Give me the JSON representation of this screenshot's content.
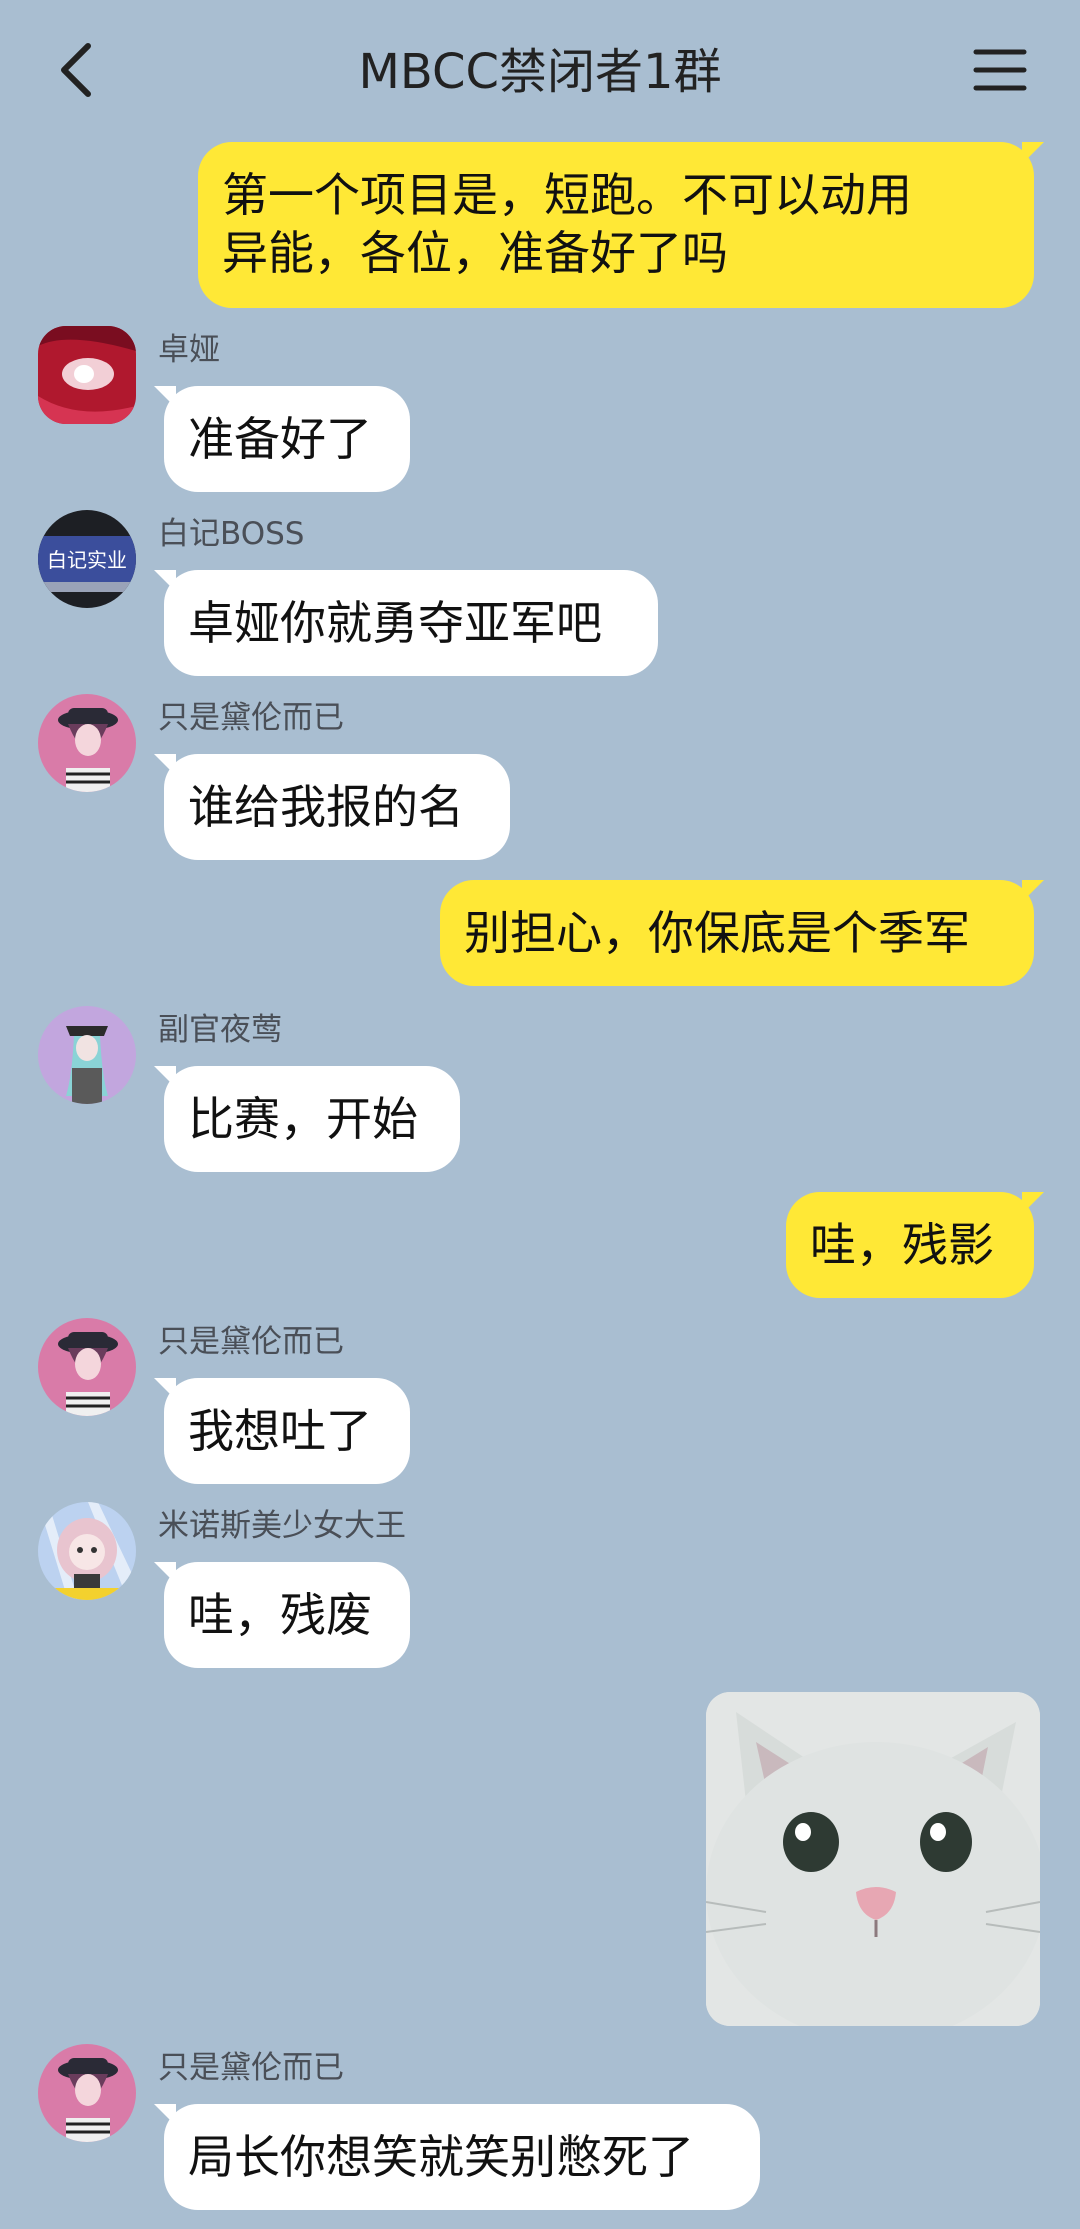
{
  "header": {
    "title": "MBCC禁闭者1群",
    "back_icon": "chevron-left-icon",
    "menu_icon": "hamburger-menu-icon"
  },
  "colors": {
    "background": "#a9bed1",
    "outgoing_bubble": "#ffe836",
    "incoming_bubble": "#ffffff"
  },
  "messages": [
    {
      "direction": "outgoing",
      "text_line1": "第一个项目是，短跑。不可以动用",
      "text_line2": "异能，各位，准备好了吗"
    },
    {
      "direction": "incoming",
      "sender": "卓娅",
      "text": "准备好了"
    },
    {
      "direction": "incoming",
      "sender": "白记BOSS",
      "avatar_text": "白记实业",
      "text": "卓娅你就勇夺亚军吧"
    },
    {
      "direction": "incoming",
      "sender": "只是黛伦而已",
      "text": "谁给我报的名"
    },
    {
      "direction": "outgoing",
      "text": "别担心，你保底是个季军"
    },
    {
      "direction": "incoming",
      "sender": "副官夜莺",
      "text": "比赛，开始"
    },
    {
      "direction": "outgoing",
      "text": "哇，残影"
    },
    {
      "direction": "incoming",
      "sender": "只是黛伦而已",
      "text": "我想吐了"
    },
    {
      "direction": "incoming",
      "sender": "米诺斯美少女大王",
      "text": "哇，残废"
    },
    {
      "direction": "outgoing",
      "type": "image",
      "image_icon": "cat-sticker-image"
    },
    {
      "direction": "incoming",
      "sender": "只是黛伦而已",
      "text": "局长你想笑就笑别憋死了"
    }
  ]
}
